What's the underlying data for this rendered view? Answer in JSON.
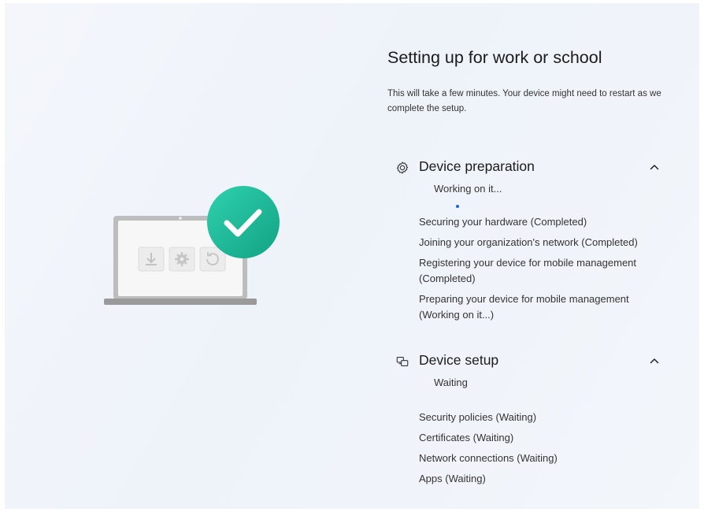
{
  "page": {
    "title": "Setting up for work or school",
    "subtitle": "This will take a few minutes. Your device might need to restart as we complete the setup."
  },
  "illustration": {
    "icons": [
      "download-icon",
      "gear-icon",
      "refresh-icon",
      "checkmark-icon"
    ],
    "accent_color": "#1fb89a"
  },
  "sections": [
    {
      "title": "Device preparation",
      "icon": "gear-icon",
      "status": "Working on it...",
      "expanded": true,
      "items": [
        "Securing your hardware (Completed)",
        "Joining your organization's network (Completed)",
        "Registering your device for mobile management (Completed)",
        "Preparing your device for mobile management (Working on it...)"
      ]
    },
    {
      "title": "Device setup",
      "icon": "devices-icon",
      "status": "Waiting",
      "expanded": true,
      "items": [
        "Security policies (Waiting)",
        "Certificates (Waiting)",
        "Network connections (Waiting)",
        "Apps (Waiting)"
      ]
    }
  ],
  "colors": {
    "progress_accent": "#1a67d6",
    "check_badge": "#1fb89a"
  }
}
